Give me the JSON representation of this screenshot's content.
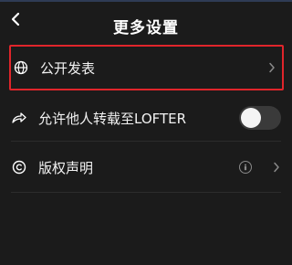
{
  "header": {
    "title": "更多设置",
    "back_icon": "chevron-left-icon"
  },
  "settings": {
    "public_post": {
      "label": "公开发表",
      "icon": "globe-icon",
      "highlight_color": "#e0252b"
    },
    "allow_repost": {
      "label": "允许他人转载至LOFTER",
      "icon": "share-arrow-icon",
      "toggle_on": false
    },
    "copyright": {
      "label": "版权声明",
      "icon": "copyright-icon",
      "badge_icon": "creative-commons-attribution-icon"
    }
  },
  "colors": {
    "background": "#1b1b1b",
    "text": "#ffffff",
    "highlight": "#e0252b"
  }
}
